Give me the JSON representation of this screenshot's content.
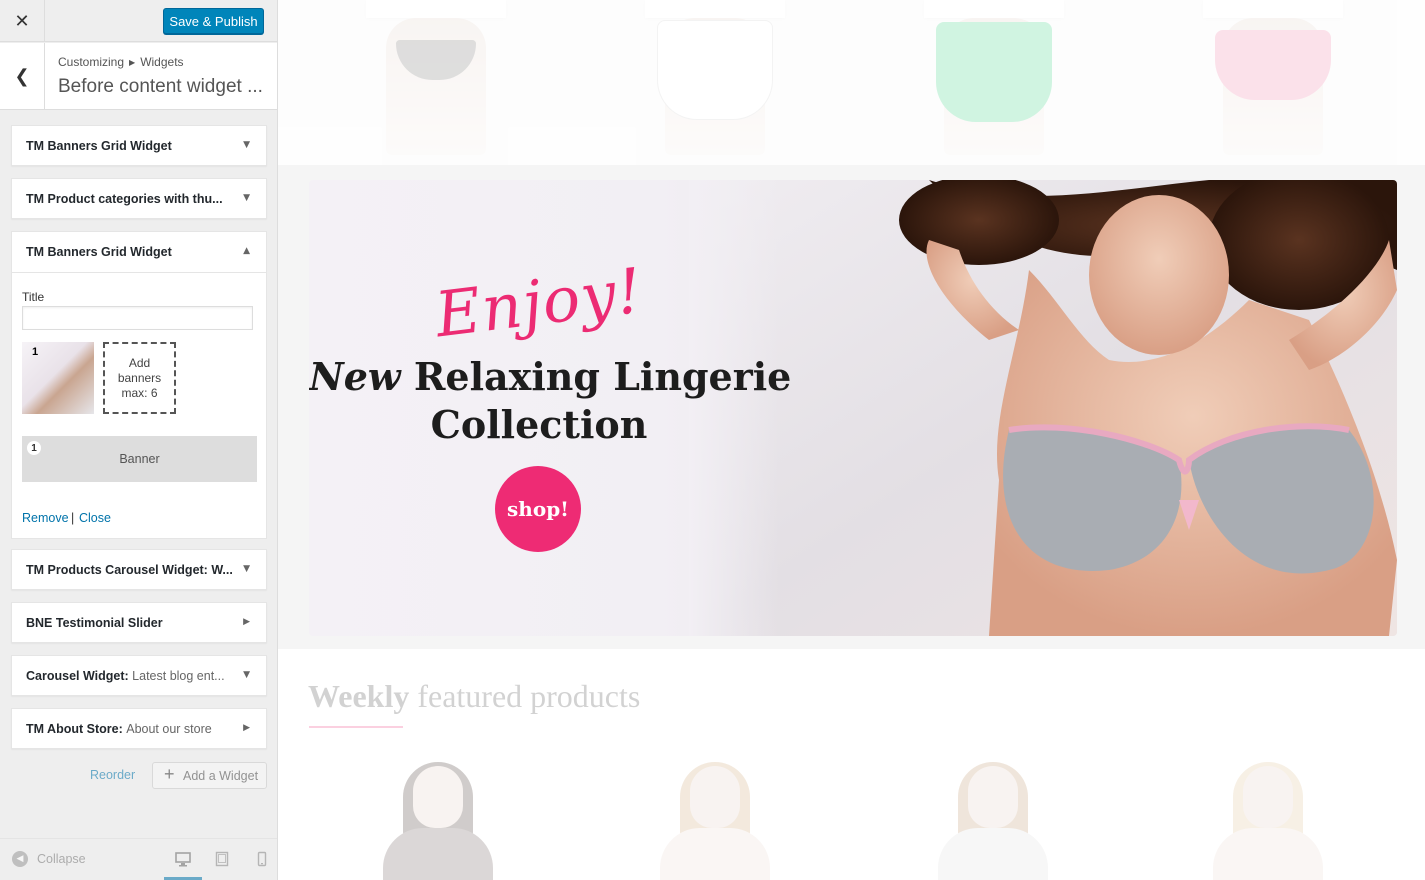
{
  "header": {
    "close_icon": "close-icon",
    "save_label": "Save & Publish",
    "accent": "#0085ba"
  },
  "panel": {
    "breadcrumb_root": "Customizing",
    "breadcrumb_child": "Widgets",
    "title": "Before content widget ...",
    "back_icon": "back-arrow-icon"
  },
  "widgets": [
    {
      "title": "TM Banners Grid Widget",
      "subtitle": "",
      "arrow": "▼"
    },
    {
      "title": "TM Product categories with thu...",
      "subtitle": "",
      "arrow": "▼"
    },
    {
      "title": "TM Banners Grid Widget",
      "subtitle": "",
      "arrow": "▲"
    },
    {
      "title": "TM Products Carousel Widget:",
      "subtitle": "W...",
      "arrow": "▼"
    },
    {
      "title": "BNE Testimonial Slider",
      "subtitle": "",
      "arrow": "▶"
    },
    {
      "title": "Carousel Widget:",
      "subtitle": "Latest blog ent...",
      "arrow": "▼"
    },
    {
      "title": "TM About Store:",
      "subtitle": "About our store",
      "arrow": "▶"
    }
  ],
  "open_widget": {
    "title_label": "Title",
    "title_value": "",
    "thumb_number": "1",
    "add_banners_text": "Add banners max: 6",
    "banner_number": "1",
    "banner_label": "Banner",
    "remove_label": "Remove",
    "separator": "|",
    "close_label": "Close"
  },
  "actions": {
    "reorder_label": "Reorder",
    "add_widget_label": "Add a Widget",
    "plus": "+"
  },
  "footer": {
    "collapse_label": "Collapse",
    "collapse_icon": "collapse-arrow-icon",
    "device_icons": [
      "desktop-icon",
      "tablet-icon",
      "mobile-icon"
    ]
  },
  "preview": {
    "banner": {
      "enjoy": "Enjoy!",
      "headline_new": "New",
      "headline_rest": " Relaxing Lingerie",
      "headline_line2": "Collection",
      "shop_label": "shop!",
      "accent": "#ee2b74"
    },
    "weekly": {
      "bold": "Weekly",
      "rest": " featured products"
    }
  }
}
